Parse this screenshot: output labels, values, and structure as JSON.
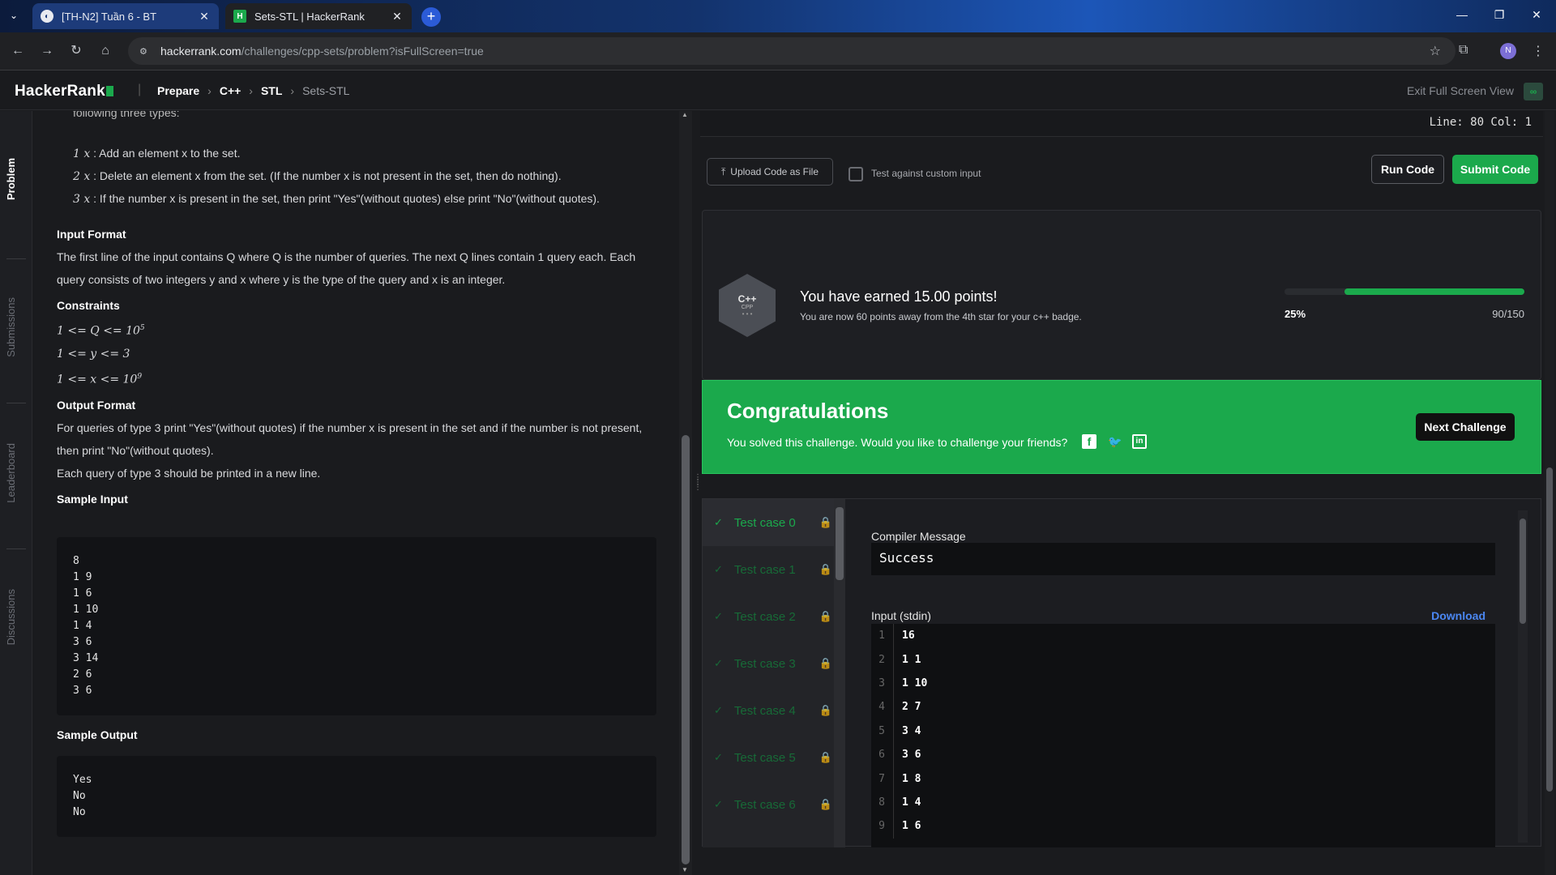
{
  "browser": {
    "tabs": [
      {
        "title": "[TH-N2] Tuần 6 - BT",
        "icon": "globe-icon"
      },
      {
        "title": "Sets-STL | HackerRank",
        "icon": "hackerrank-favicon"
      }
    ],
    "url_host": "hackerrank.com",
    "url_path": "/challenges/cpp-sets/problem?isFullScreen=true",
    "profile_initial": "N"
  },
  "header": {
    "logo": "HackerRank",
    "breadcrumbs": [
      "Prepare",
      "C++",
      "STL",
      "Sets-STL"
    ],
    "exit_fullscreen": "Exit Full Screen View"
  },
  "rail": {
    "problem": "Problem",
    "submissions": "Submissions",
    "leaderboard": "Leaderboard",
    "discussions": "Discussions"
  },
  "problem": {
    "cut_text": "following three types:",
    "query1": ": Add an element x to the set.",
    "query2": ": Delete an element x from the set. (If the number x is not present in the set, then do nothing).",
    "query3": ": If the number x is present in the set, then print \"Yes\"(without quotes) else print \"No\"(without quotes).",
    "input_format_title": "Input Format",
    "input_format_1": "The first line of the input contains Q where Q is the number of queries. The next Q lines contain 1 query each. Each",
    "input_format_2": "query consists of two integers y and x where y is the type of the query and x is an integer.",
    "constraints_title": "Constraints",
    "constraint_1": "1 <= Q <= 10",
    "constraint_1_exp": "5",
    "constraint_2": "1 <= y <= 3",
    "constraint_3": "1 <= x <= 10",
    "constraint_3_exp": "9",
    "output_format_title": "Output Format",
    "output_format_1": "For queries of type 3 print \"Yes\"(without quotes) if the number x is present in the set and if the number is not present,",
    "output_format_2": "then print \"No\"(without quotes).",
    "output_format_3": "Each query of type 3 should be printed in a new line.",
    "sample_input_title": "Sample Input",
    "sample_input": [
      "8",
      "1 9",
      "1 6",
      "1 10",
      "1 4",
      "3 6",
      "3 14",
      "2 6",
      "3 6"
    ],
    "sample_output_title": "Sample Output",
    "sample_output": [
      "Yes",
      "No",
      "No"
    ]
  },
  "editor": {
    "line_col": "Line: 80 Col: 1",
    "upload_label": "Upload Code as File",
    "custom_input_label": "Test against custom input",
    "run_label": "Run Code",
    "submit_label": "Submit Code"
  },
  "points": {
    "badge_line1": "C++",
    "badge_line2": "CPP",
    "title": "You have earned 15.00 points!",
    "subtitle": "You are now 60 points away from the 4th star for your c++ badge.",
    "percent": "25%",
    "progress_text": "90/150",
    "progress_fraction": 0.75
  },
  "congrats": {
    "title": "Congratulations",
    "message": "You solved this challenge. Would you like to challenge your friends?",
    "next_label": "Next Challenge"
  },
  "testcases": [
    "Test case 0",
    "Test case 1",
    "Test case 2",
    "Test case 3",
    "Test case 4",
    "Test case 5",
    "Test case 6"
  ],
  "result": {
    "compiler_label": "Compiler Message",
    "compiler_message": "Success",
    "input_label": "Input (stdin)",
    "download_label": "Download",
    "input_lines": [
      {
        "n": "1",
        "t": "16"
      },
      {
        "n": "2",
        "t": "1 1"
      },
      {
        "n": "3",
        "t": "1 10"
      },
      {
        "n": "4",
        "t": "2 7"
      },
      {
        "n": "5",
        "t": "3 4"
      },
      {
        "n": "6",
        "t": "3 6"
      },
      {
        "n": "7",
        "t": "1 8"
      },
      {
        "n": "8",
        "t": "1 4"
      },
      {
        "n": "9",
        "t": "1 6"
      }
    ]
  },
  "colors": {
    "accent": "#1ba94c",
    "link": "#4b87f2",
    "bg": "#1a1b1e"
  }
}
